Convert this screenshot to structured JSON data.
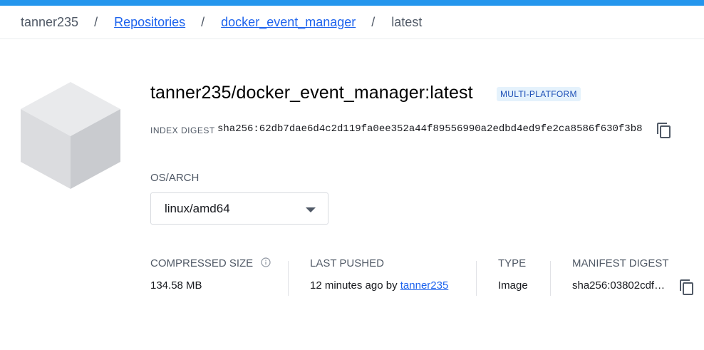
{
  "breadcrumb": {
    "user": "tanner235",
    "separator": "/",
    "repositories": "Repositories",
    "repo": "docker_event_manager",
    "tag": "latest"
  },
  "header": {
    "title": "tanner235/docker_event_manager:latest",
    "badge": "MULTI-PLATFORM"
  },
  "index_digest": {
    "label": "INDEX DIGEST",
    "value": "sha256:62db7dae6d4c2d119fa0ee352a44f89556990a2edbd4ed9fe2ca8586f630f3b8"
  },
  "os_arch": {
    "label": "OS/ARCH",
    "selected": "linux/amd64"
  },
  "details": {
    "compressed_size_label": "COMPRESSED SIZE",
    "compressed_size_value": "134.58 MB",
    "last_pushed_label": "LAST PUSHED",
    "last_pushed_text": "12 minutes ago by",
    "last_pushed_user": "tanner235",
    "type_label": "TYPE",
    "type_value": "Image",
    "manifest_digest_label": "MANIFEST DIGEST",
    "manifest_digest_value": "sha256:03802cdf…"
  },
  "icons": {
    "cube": "image-cube-icon",
    "copy": "copy-icon",
    "info": "info-icon",
    "dropdown": "chevron-down-icon"
  },
  "colors": {
    "accent": "#2496ed",
    "link": "#1d63ed",
    "badge_bg": "#e5f2fc",
    "badge_text": "#1d4fb6"
  }
}
